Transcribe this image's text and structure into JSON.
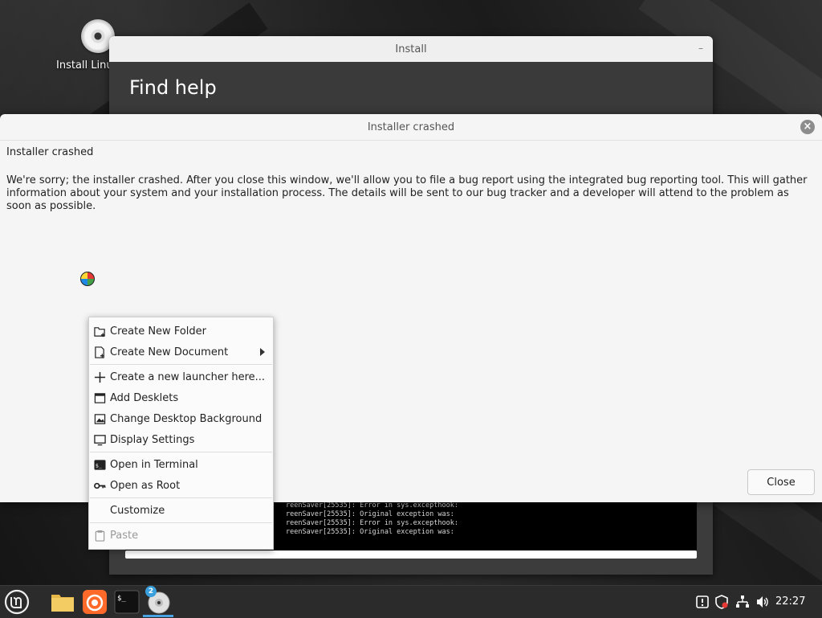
{
  "desktop": {
    "icon_label": "Install Linu"
  },
  "install_window": {
    "title": "Install",
    "minimize_label": "–",
    "heading": "Find help",
    "terminal_lines": [
      "reenSaver[25535]: Error in sys.excepthook:",
      "reenSaver[25535]: Original exception was:",
      "reenSaver[25535]: Error in sys.excepthook:",
      "reenSaver[25535]: Original exception was:"
    ]
  },
  "crash_dialog": {
    "title": "Installer crashed",
    "heading": "Installer crashed",
    "body": "We're sorry; the installer crashed. After you close this window, we'll allow you to file a bug report using the integrated bug reporting tool. This will gather information about your system and your installation process. The details will be sent to our bug tracker and a developer will attend to the problem as soon as possible.",
    "close_button": "Close",
    "close_icon": "×"
  },
  "context_menu": {
    "items": [
      {
        "label": "Create New Folder",
        "icon": "new-folder-icon"
      },
      {
        "label": "Create New Document",
        "icon": "new-document-icon",
        "submenu": true
      },
      {
        "label": "Create a new launcher here...",
        "icon": "plus-icon"
      },
      {
        "label": "Add Desklets",
        "icon": "desklet-icon"
      },
      {
        "label": "Change Desktop Background",
        "icon": "image-icon"
      },
      {
        "label": "Display Settings",
        "icon": "monitor-icon"
      },
      {
        "label": "Open in Terminal",
        "icon": "terminal-icon"
      },
      {
        "label": "Open as Root",
        "icon": "key-icon"
      },
      {
        "label": "Customize",
        "icon": ""
      },
      {
        "label": "Paste",
        "icon": "clipboard-icon",
        "disabled": true
      }
    ]
  },
  "taskbar": {
    "badge_count": "2",
    "clock": "22:27"
  }
}
